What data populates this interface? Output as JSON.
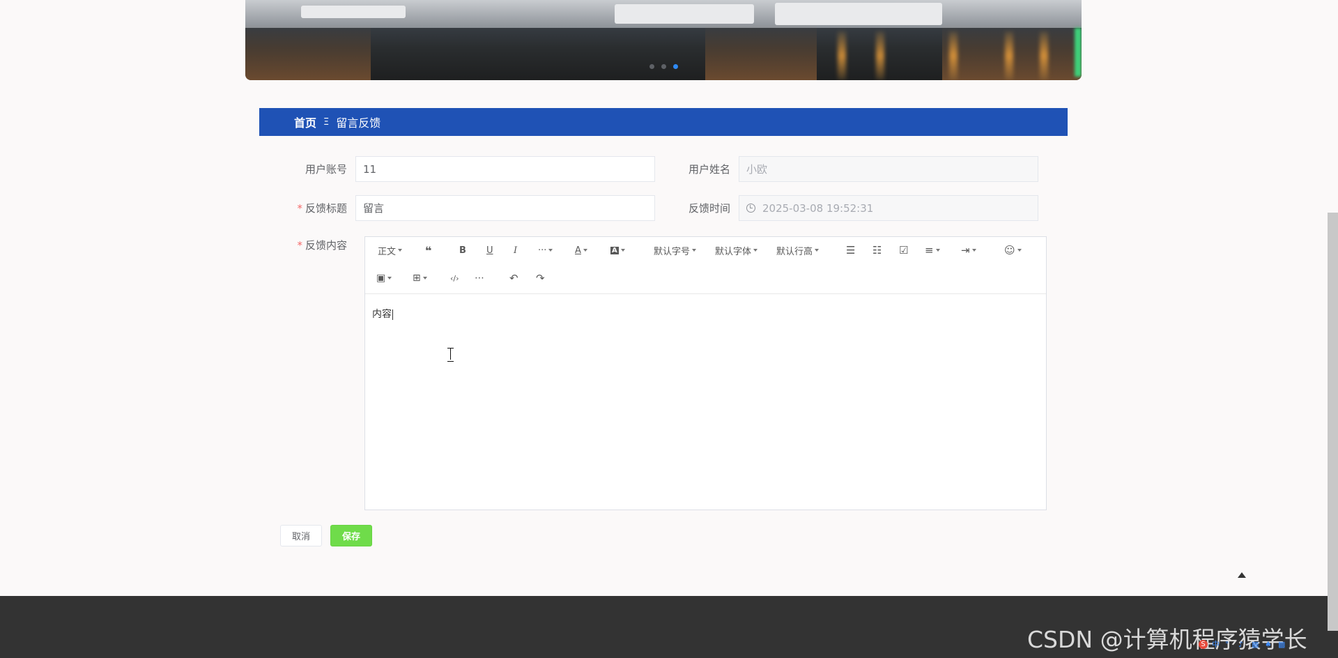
{
  "breadcrumb": {
    "home": "首页",
    "separator": "Ξ",
    "current": "留言反馈"
  },
  "form": {
    "account": {
      "label": "用户账号",
      "value": "11"
    },
    "name": {
      "label": "用户姓名",
      "value": "小欧"
    },
    "title": {
      "label": "反馈标题",
      "required_mark": "*",
      "value": "留言"
    },
    "time": {
      "label": "反馈时间",
      "value": "2025-03-08 19:52:31"
    },
    "content": {
      "label": "反馈内容",
      "required_mark": "*",
      "value": "内容"
    }
  },
  "editor": {
    "toolbar": {
      "heading": "正文",
      "more": "···",
      "font_color": "A",
      "bg_color": "A",
      "font_size": "默认字号",
      "font_family": "默认字体",
      "line_height": "默认行高"
    }
  },
  "buttons": {
    "cancel": "取消",
    "save": "保存"
  },
  "banner": {
    "slide_count": 3,
    "active_slide": 3
  },
  "watermark": "CSDN @计算机程序猿学长",
  "colors": {
    "header_blue": "#1f52b5",
    "save_green": "#6fdc4a",
    "required_red": "#f56c6c",
    "footer": "#333333"
  }
}
